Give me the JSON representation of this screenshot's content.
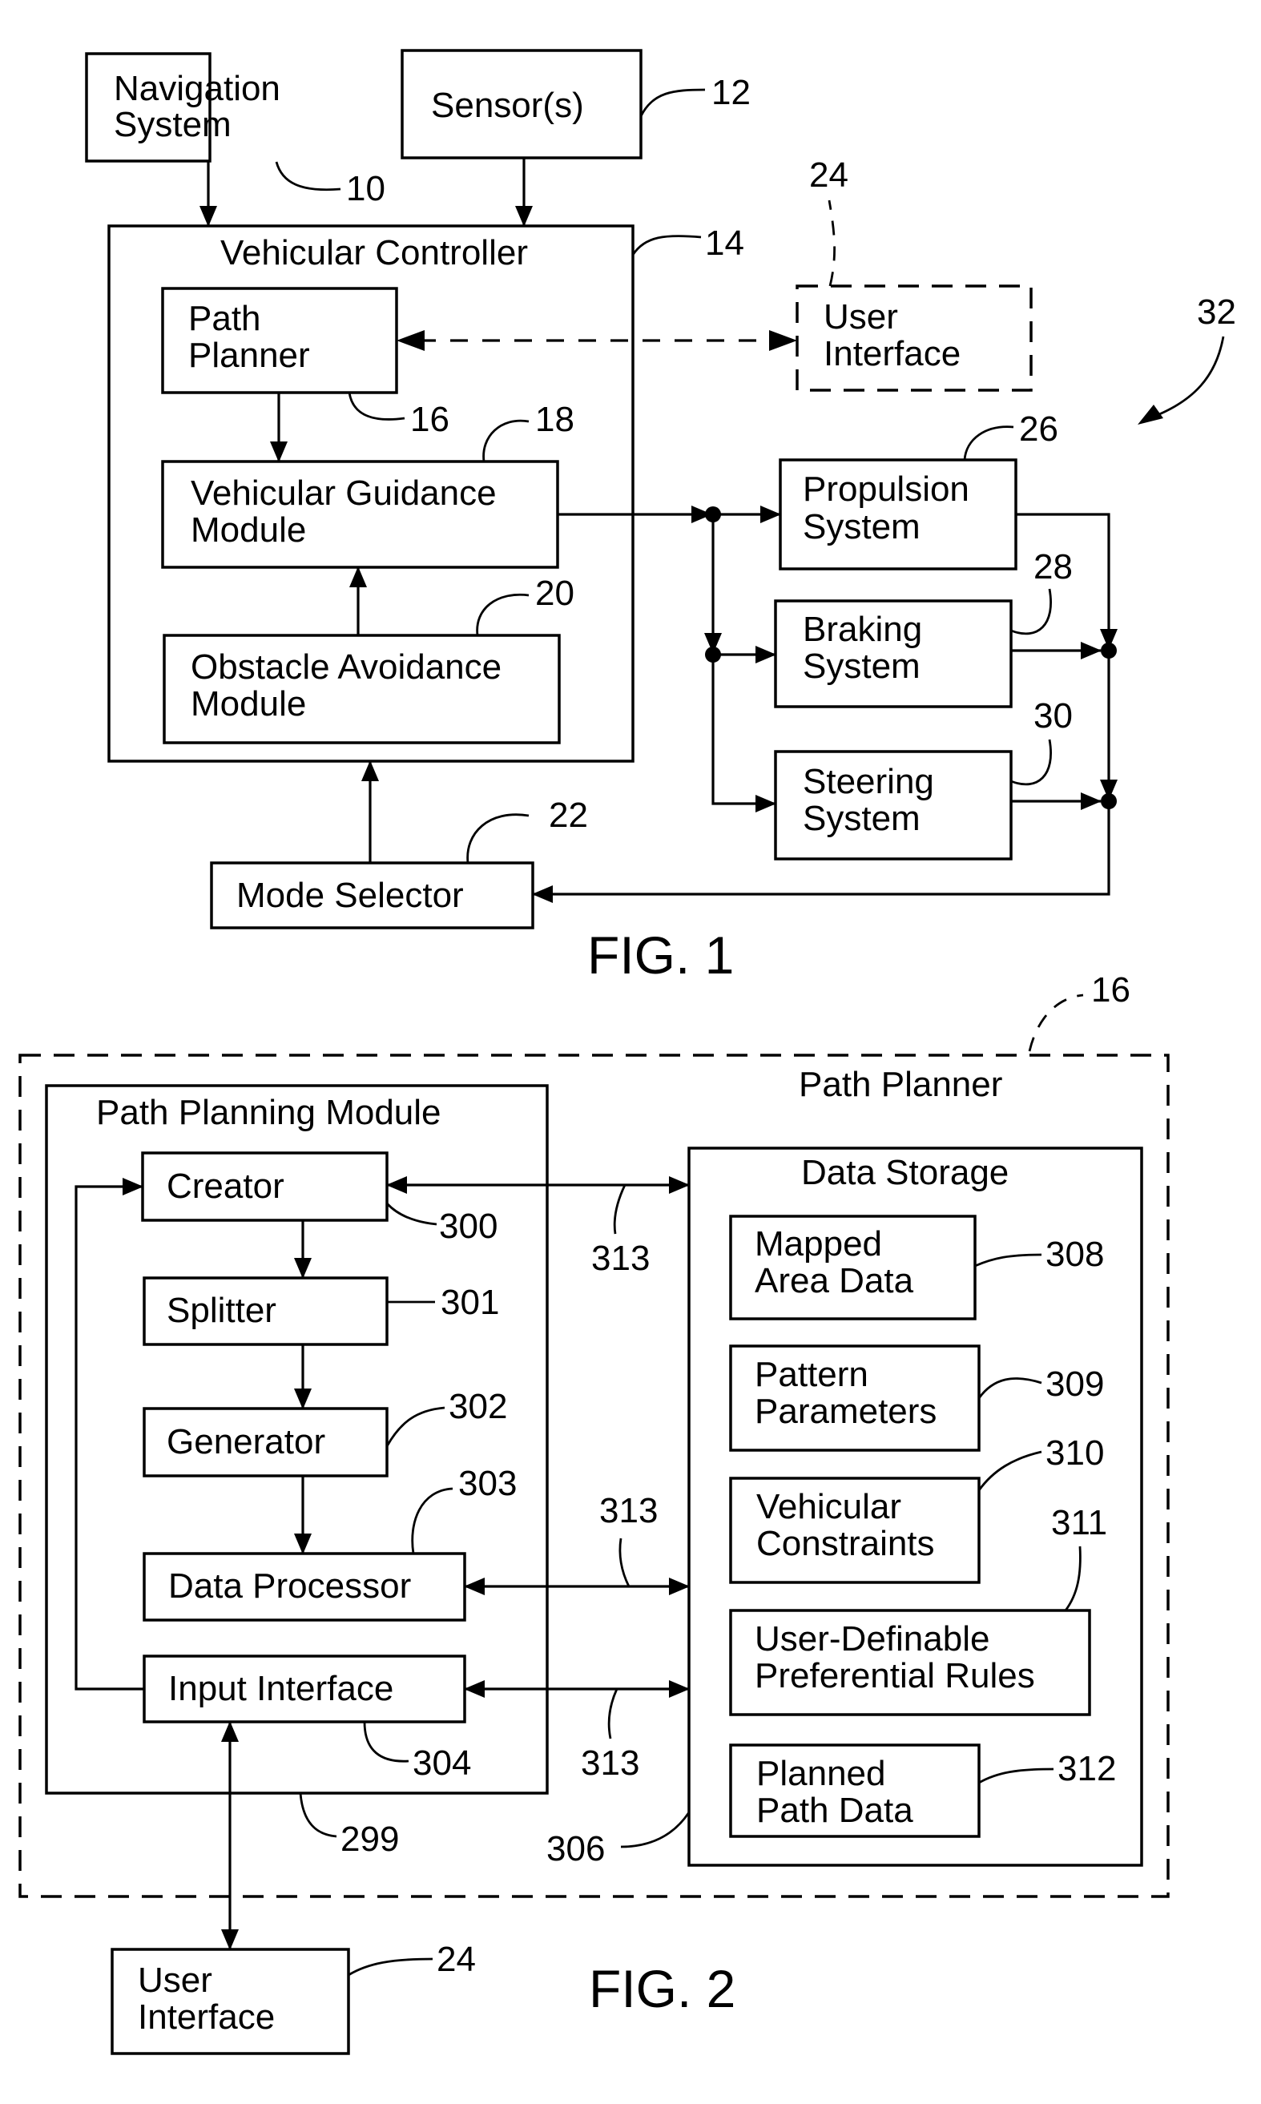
{
  "fig1": {
    "caption": "FIG. 1",
    "boxes": {
      "navigation_system": [
        "Navigation",
        "System"
      ],
      "sensors": [
        "Sensor(s)"
      ],
      "vehicular_controller": "Vehicular Controller",
      "path_planner": [
        "Path",
        "Planner"
      ],
      "vehicular_guidance_module": [
        "Vehicular Guidance",
        "Module"
      ],
      "obstacle_avoidance_module": [
        "Obstacle Avoidance",
        "Module"
      ],
      "user_interface": [
        "User",
        "Interface"
      ],
      "propulsion_system": [
        "Propulsion",
        "System"
      ],
      "braking_system": [
        "Braking",
        "System"
      ],
      "steering_system": [
        "Steering",
        "System"
      ],
      "mode_selector": [
        "Mode Selector"
      ]
    },
    "refs": {
      "navigation_system": "10",
      "sensors": "12",
      "vehicular_controller": "14",
      "path_planner": "16",
      "vehicular_guidance_module": "18",
      "obstacle_avoidance_module": "20",
      "mode_selector": "22",
      "user_interface": "24",
      "propulsion_system": "26",
      "braking_system": "28",
      "steering_system": "30",
      "system": "32"
    }
  },
  "fig2": {
    "caption": "FIG. 2",
    "boxes": {
      "path_planner": "Path Planner",
      "path_planning_module": "Path Planning Module",
      "creator": [
        "Creator"
      ],
      "splitter": [
        "Splitter"
      ],
      "generator": [
        "Generator"
      ],
      "data_processor": [
        "Data Processor"
      ],
      "input_interface": [
        "Input Interface"
      ],
      "data_storage": "Data Storage",
      "mapped_area_data": [
        "Mapped",
        "Area Data"
      ],
      "pattern_parameters": [
        "Pattern",
        "Parameters"
      ],
      "vehicular_constraints": [
        "Vehicular",
        "Constraints"
      ],
      "user_definable_preferential_rules": [
        "User-Definable",
        "Preferential Rules"
      ],
      "planned_path_data": [
        "Planned",
        "Path Data"
      ],
      "user_interface": [
        "User",
        "Interface"
      ]
    },
    "refs": {
      "path_planner": "16",
      "path_planning_module": "299",
      "creator": "300",
      "splitter": "301",
      "generator": "302",
      "data_processor": "303",
      "input_interface": "304",
      "data_storage": "306",
      "mapped_area_data": "308",
      "pattern_parameters": "309",
      "vehicular_constraints": "310",
      "user_definable_preferential_rules": "311",
      "planned_path_data": "312",
      "link_creator": "313",
      "link_data_processor": "313",
      "link_input_interface": "313",
      "user_interface": "24"
    }
  }
}
